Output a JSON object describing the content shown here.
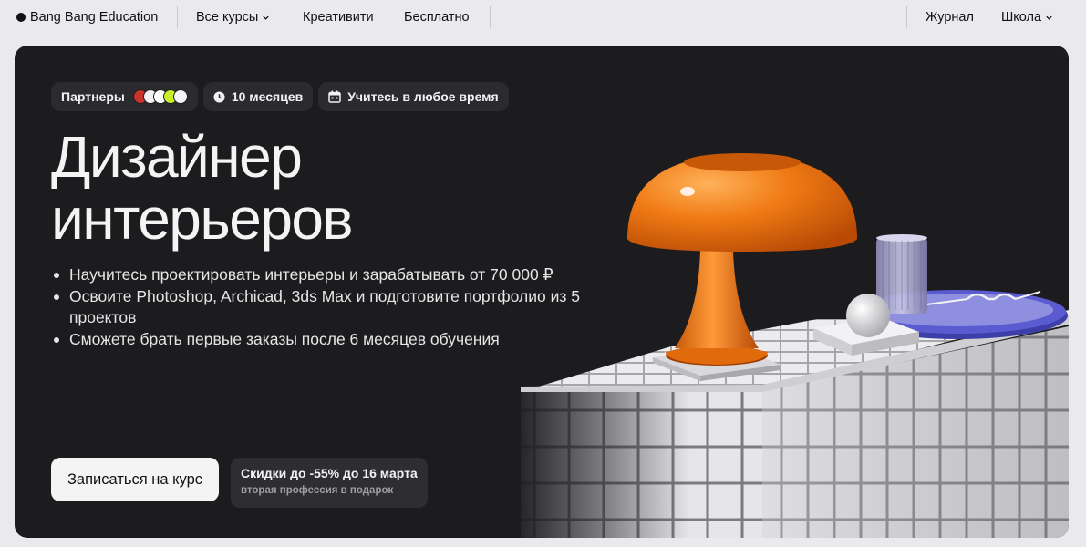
{
  "nav": {
    "brand": "Bang Bang Education",
    "all_courses": "Все курсы",
    "creativity": "Креативити",
    "free": "Бесплатно",
    "journal": "Журнал",
    "school": "Школа"
  },
  "hero": {
    "chips": {
      "partners_label": "Партнеры",
      "duration": "10 месяцев",
      "schedule": "Учитесь в любое время"
    },
    "title_line1": "Дизайнер",
    "title_line2": "интерьеров",
    "bullets": [
      "Научитесь проектировать интерьеры и зарабатывать от 70 000 ₽",
      "Освоите Photoshop, Archicad, 3ds Max и подготовите портфолио из 5 проектов",
      "Сможете брать первые заказы после 6 месяцев обучения"
    ],
    "cta_label": "Записаться на курс",
    "promo_title": "Скидки до -55% до 16 марта",
    "promo_subtitle": "вторая профессия в подарок"
  },
  "icons": {
    "brand": "dot-icon",
    "dropdown": "chevron-down-icon",
    "duration": "clock-icon",
    "schedule": "calendar-icon"
  },
  "colors": {
    "page_bg": "#e9e9ee",
    "hero_bg": "#1c1b1e",
    "chip_bg": "#2b2a2e",
    "lamp_orange": "#f07a14",
    "tray_purple": "#5a5bd0",
    "tile_white": "#e8e8ea"
  }
}
